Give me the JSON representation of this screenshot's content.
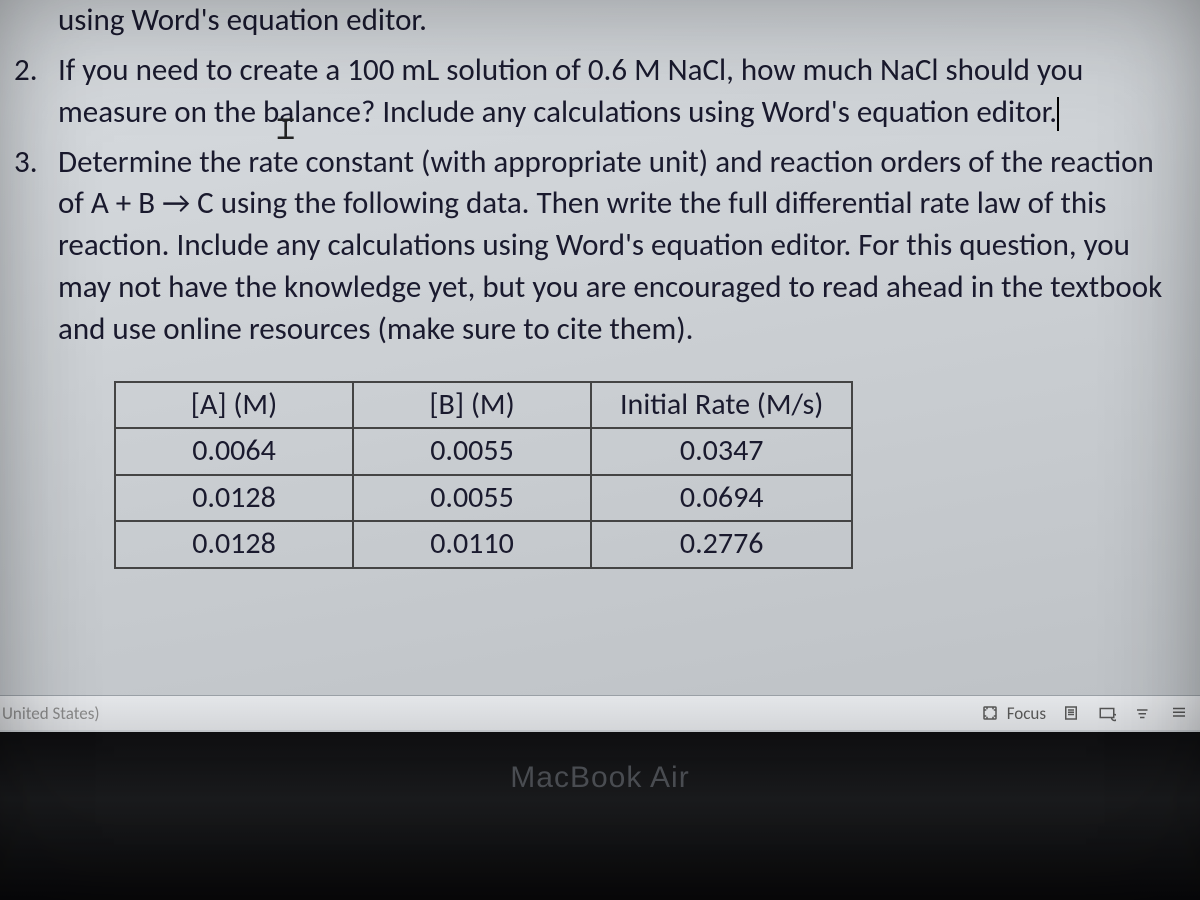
{
  "document": {
    "fragment": "using Word's equation editor.",
    "item2_num": "2.",
    "item2_text": "If you need to create a 100 mL solution of 0.6 M NaCl, how much NaCl should you measure on the balance? Include any calculations using Word's equation editor.",
    "item3_num": "3.",
    "item3_text": "Determine the rate constant (with appropriate unit) and reaction orders of the reaction of A + B → C using the following data. Then write the full differential rate law of this reaction. Include any calculations using Word's equation editor. For this question, you may not have the knowledge yet, but you are encouraged to read ahead in the textbook and use online resources (make sure to cite them)."
  },
  "table": {
    "h1": "[A] (M)",
    "h2": "[B] (M)",
    "h3": "Initial Rate (M/s)",
    "r1c1": "0.0064",
    "r1c2": "0.0055",
    "r1c3": "0.0347",
    "r2c1": "0.0128",
    "r2c2": "0.0055",
    "r2c3": "0.0694",
    "r3c1": "0.0128",
    "r3c2": "0.0110",
    "r3c3": "0.2776"
  },
  "statusbar": {
    "lang": "United States)",
    "focus": "Focus"
  },
  "hardware": {
    "label": "MacBook Air"
  }
}
